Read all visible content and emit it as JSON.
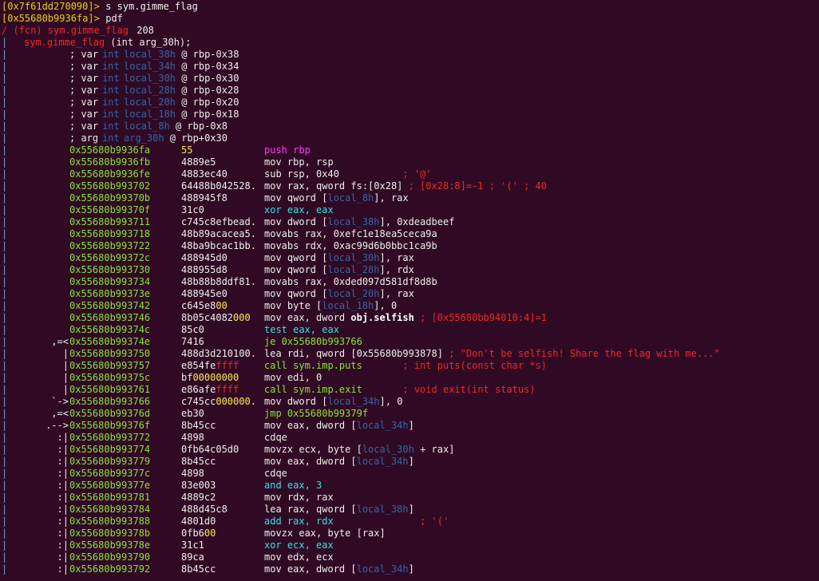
{
  "header": {
    "prompt1": "[0x7f61dd270090]>",
    "cmd1": " s sym.gimme_flag",
    "prompt2": "[0x55680b9936fa]>",
    "cmd2": " pdf",
    "fcn_open": "/ (fcn) sym.gimme_flag",
    "fcn_size": " 208",
    "sig_name": "sym.gimme_flag",
    "sig_rest": " (int arg_30h);"
  },
  "vars": [
    {
      "kw": "; var",
      "type": "int",
      "name": "local_38h",
      "ref": "@ rbp-0x38"
    },
    {
      "kw": "; var",
      "type": "int",
      "name": "local_34h",
      "ref": "@ rbp-0x34"
    },
    {
      "kw": "; var",
      "type": "int",
      "name": "local_30h",
      "ref": "@ rbp-0x30"
    },
    {
      "kw": "; var",
      "type": "int",
      "name": "local_28h",
      "ref": "@ rbp-0x28"
    },
    {
      "kw": "; var",
      "type": "int",
      "name": "local_20h",
      "ref": "@ rbp-0x20"
    },
    {
      "kw": "; var",
      "type": "int",
      "name": "local_18h",
      "ref": "@ rbp-0x18"
    },
    {
      "kw": "; var",
      "type": "int",
      "name": "local_8h",
      "ref": "@ rbp-0x8"
    },
    {
      "kw": "; arg",
      "type": "int",
      "name": "arg_30h",
      "ref": "@ rbp+0x30"
    }
  ],
  "rows": [
    {
      "flow": "",
      "addr": "0x55680b9936fa",
      "bytes": [
        [
          "55",
          "y"
        ]
      ],
      "asm": [
        [
          "push rbp",
          "m"
        ]
      ]
    },
    {
      "flow": "",
      "addr": "0x55680b9936fb",
      "bytes": [
        [
          "4889e5",
          "w"
        ]
      ],
      "asm": [
        [
          "mov rbp, rsp",
          "w"
        ]
      ]
    },
    {
      "flow": "",
      "addr": "0x55680b9936fe",
      "bytes": [
        [
          "4883ec40",
          "w"
        ]
      ],
      "asm": [
        [
          "sub rsp, 0x40",
          "w"
        ],
        [
          "           ; '@'",
          "r"
        ]
      ]
    },
    {
      "flow": "",
      "addr": "0x55680b993702",
      "bytes": [
        [
          "64488b042528.",
          "w"
        ]
      ],
      "asm": [
        [
          "mov rax, qword fs:[0x28]",
          "w"
        ],
        [
          " ; [0x28:8]=-1 ; '(' ; 40",
          "r"
        ]
      ]
    },
    {
      "flow": "",
      "addr": "0x55680b99370b",
      "bytes": [
        [
          "488945f8",
          "w"
        ]
      ],
      "asm": [
        [
          "mov qword [",
          "w"
        ],
        [
          "local_8h",
          "b"
        ],
        [
          "], rax",
          "w"
        ]
      ]
    },
    {
      "flow": "",
      "addr": "0x55680b99370f",
      "bytes": [
        [
          "31c0",
          "w"
        ]
      ],
      "asm": [
        [
          "xor eax, eax",
          "c"
        ]
      ]
    },
    {
      "flow": "",
      "addr": "0x55680b993711",
      "bytes": [
        [
          "c745c8efbead.",
          "w"
        ]
      ],
      "asm": [
        [
          "mov dword [",
          "w"
        ],
        [
          "local_38h",
          "b"
        ],
        [
          "], 0xdeadbeef",
          "w"
        ]
      ]
    },
    {
      "flow": "",
      "addr": "0x55680b993718",
      "bytes": [
        [
          "48b89acacea5.",
          "w"
        ]
      ],
      "asm": [
        [
          "movabs rax, 0xefc1e18ea5ceca9a",
          "w"
        ]
      ]
    },
    {
      "flow": "",
      "addr": "0x55680b993722",
      "bytes": [
        [
          "48ba9bcac1bb.",
          "w"
        ]
      ],
      "asm": [
        [
          "movabs rdx, 0xac99d6b0bbc1ca9b",
          "w"
        ]
      ]
    },
    {
      "flow": "",
      "addr": "0x55680b99372c",
      "bytes": [
        [
          "488945d0",
          "w"
        ]
      ],
      "asm": [
        [
          "mov qword [",
          "w"
        ],
        [
          "local_30h",
          "b"
        ],
        [
          "], rax",
          "w"
        ]
      ]
    },
    {
      "flow": "",
      "addr": "0x55680b993730",
      "bytes": [
        [
          "488955d8",
          "w"
        ]
      ],
      "asm": [
        [
          "mov qword [",
          "w"
        ],
        [
          "local_28h",
          "b"
        ],
        [
          "], rdx",
          "w"
        ]
      ]
    },
    {
      "flow": "",
      "addr": "0x55680b993734",
      "bytes": [
        [
          "48b88b8ddf81.",
          "w"
        ]
      ],
      "asm": [
        [
          "movabs rax, 0xded097d581df8d8b",
          "w"
        ]
      ]
    },
    {
      "flow": "",
      "addr": "0x55680b99373e",
      "bytes": [
        [
          "488945e0",
          "w"
        ]
      ],
      "asm": [
        [
          "mov qword [",
          "w"
        ],
        [
          "local_20h",
          "b"
        ],
        [
          "], rax",
          "w"
        ]
      ]
    },
    {
      "flow": "",
      "addr": "0x55680b993742",
      "bytes": [
        [
          "c645e8",
          "w"
        ],
        [
          "00",
          "y"
        ]
      ],
      "asm": [
        [
          "mov byte [",
          "w"
        ],
        [
          "local_18h",
          "b"
        ],
        [
          "], 0",
          "w"
        ]
      ]
    },
    {
      "flow": "",
      "addr": "0x55680b993746",
      "bytes": [
        [
          "8b05c4082",
          "w"
        ],
        [
          "000",
          "y"
        ]
      ],
      "asm": [
        [
          "mov eax, dword ",
          "w"
        ],
        [
          "obj.selfish",
          "wb"
        ],
        [
          " ; [0x55680bb94010:4]=1",
          "r"
        ]
      ]
    },
    {
      "flow": "",
      "addr": "0x55680b99374c",
      "bytes": [
        [
          "85c0",
          "w"
        ]
      ],
      "asm": [
        [
          "test eax, eax",
          "c"
        ]
      ]
    },
    {
      "flow": ",=<",
      "addr": "0x55680b99374e",
      "bytes": [
        [
          "7416",
          "w"
        ]
      ],
      "asm": [
        [
          "je 0x55680b993766",
          "g"
        ]
      ]
    },
    {
      "flow": "|",
      "addr": "0x55680b993750",
      "bytes": [
        [
          "488d3d210100.",
          "w"
        ]
      ],
      "asm": [
        [
          "lea rdi, qword [0x55680b993878]",
          "w"
        ],
        [
          " ; \"Don't be selfish! Share the flag with me...\"",
          "r"
        ]
      ]
    },
    {
      "flow": "|",
      "addr": "0x55680b993757",
      "bytes": [
        [
          "e854fe",
          "w"
        ],
        [
          "ffff",
          "r"
        ]
      ],
      "asm": [
        [
          "call sym.imp.puts",
          "g"
        ],
        [
          "       ; int puts(const char *s)",
          "r"
        ]
      ]
    },
    {
      "flow": "|",
      "addr": "0x55680b99375c",
      "bytes": [
        [
          "bf",
          "w"
        ],
        [
          "00000000",
          "y"
        ]
      ],
      "asm": [
        [
          "mov edi, 0",
          "w"
        ]
      ]
    },
    {
      "flow": "|",
      "addr": "0x55680b993761",
      "bytes": [
        [
          "e86afe",
          "w"
        ],
        [
          "ffff",
          "r"
        ]
      ],
      "asm": [
        [
          "call sym.imp.exit",
          "g"
        ],
        [
          "       ; void exit(int status)",
          "r"
        ]
      ]
    },
    {
      "flow": "`->",
      "addr": "0x55680b993766",
      "bytes": [
        [
          "c745cc",
          "w"
        ],
        [
          "000000",
          "y"
        ],
        [
          ".",
          "w"
        ]
      ],
      "asm": [
        [
          "mov dword [",
          "w"
        ],
        [
          "local_34h",
          "b"
        ],
        [
          "], 0",
          "w"
        ]
      ]
    },
    {
      "flow": ",=<",
      "addr": "0x55680b99376d",
      "bytes": [
        [
          "eb30",
          "w"
        ]
      ],
      "asm": [
        [
          "jmp 0x55680b99379f",
          "g"
        ]
      ]
    },
    {
      "flow": ".-->",
      "addr": "0x55680b99376f",
      "bytes": [
        [
          "8b45cc",
          "w"
        ]
      ],
      "asm": [
        [
          "mov eax, dword [",
          "w"
        ],
        [
          "local_34h",
          "b"
        ],
        [
          "]",
          "w"
        ]
      ]
    },
    {
      "flow": ":|",
      "addr": "0x55680b993772",
      "bytes": [
        [
          "4898",
          "w"
        ]
      ],
      "asm": [
        [
          "cdqe",
          "w"
        ]
      ]
    },
    {
      "flow": ":|",
      "addr": "0x55680b993774",
      "bytes": [
        [
          "0fb64c05d0",
          "w"
        ]
      ],
      "asm": [
        [
          "movzx ecx, byte [",
          "w"
        ],
        [
          "local_30h",
          "b"
        ],
        [
          " + rax]",
          "w"
        ]
      ]
    },
    {
      "flow": ":|",
      "addr": "0x55680b993779",
      "bytes": [
        [
          "8b45cc",
          "w"
        ]
      ],
      "asm": [
        [
          "mov eax, dword [",
          "w"
        ],
        [
          "local_34h",
          "b"
        ],
        [
          "]",
          "w"
        ]
      ]
    },
    {
      "flow": ":|",
      "addr": "0x55680b99377c",
      "bytes": [
        [
          "4898",
          "w"
        ]
      ],
      "asm": [
        [
          "cdqe",
          "w"
        ]
      ]
    },
    {
      "flow": ":|",
      "addr": "0x55680b99377e",
      "bytes": [
        [
          "83e003",
          "w"
        ]
      ],
      "asm": [
        [
          "and eax, 3",
          "c"
        ]
      ]
    },
    {
      "flow": ":|",
      "addr": "0x55680b993781",
      "bytes": [
        [
          "4889c2",
          "w"
        ]
      ],
      "asm": [
        [
          "mov rdx, rax",
          "w"
        ]
      ]
    },
    {
      "flow": ":|",
      "addr": "0x55680b993784",
      "bytes": [
        [
          "488d45c8",
          "w"
        ]
      ],
      "asm": [
        [
          "lea rax, qword [",
          "w"
        ],
        [
          "local_38h",
          "b"
        ],
        [
          "]",
          "w"
        ]
      ]
    },
    {
      "flow": ":|",
      "addr": "0x55680b993788",
      "bytes": [
        [
          "4801d0",
          "w"
        ]
      ],
      "asm": [
        [
          "add rax, rdx",
          "c"
        ],
        [
          "               ; '('",
          "r"
        ]
      ]
    },
    {
      "flow": ":|",
      "addr": "0x55680b99378b",
      "bytes": [
        [
          "0fb6",
          "w"
        ],
        [
          "00",
          "y"
        ]
      ],
      "asm": [
        [
          "movzx eax, byte [rax]",
          "w"
        ]
      ]
    },
    {
      "flow": ":|",
      "addr": "0x55680b99378e",
      "bytes": [
        [
          "31c1",
          "w"
        ]
      ],
      "asm": [
        [
          "xor ecx, eax",
          "c"
        ]
      ]
    },
    {
      "flow": ":|",
      "addr": "0x55680b993790",
      "bytes": [
        [
          "89ca",
          "w"
        ]
      ],
      "asm": [
        [
          "mov edx, ecx",
          "w"
        ]
      ]
    },
    {
      "flow": ":|",
      "addr": "0x55680b993792",
      "bytes": [
        [
          "8b45cc",
          "w"
        ]
      ],
      "asm": [
        [
          "mov eax, dword [",
          "w"
        ],
        [
          "local_34h",
          "b"
        ],
        [
          "]",
          "w"
        ]
      ]
    }
  ]
}
